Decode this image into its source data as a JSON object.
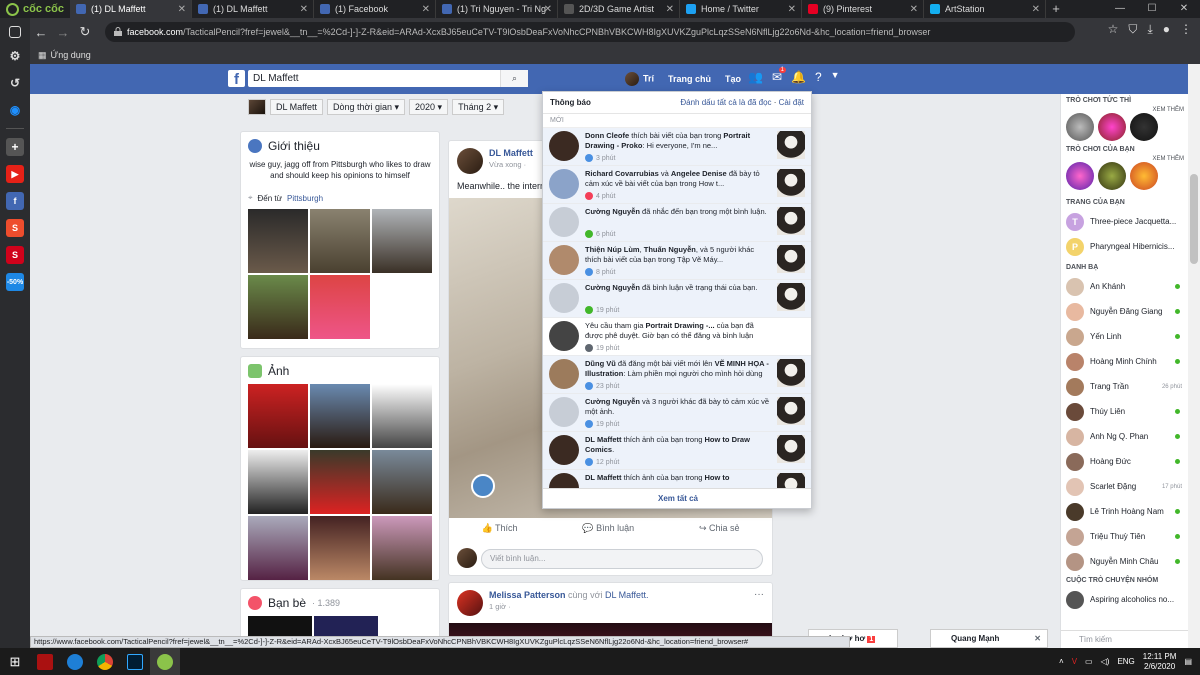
{
  "browser": {
    "brand": "cốc cốc",
    "tabs": [
      {
        "title": "(1) DL Maffett",
        "icon": "facebook-icon",
        "color": "#4267b2"
      },
      {
        "title": "(1) DL Maffett",
        "icon": "facebook-icon",
        "color": "#4267b2"
      },
      {
        "title": "(1) Facebook",
        "icon": "facebook-icon",
        "color": "#4267b2"
      },
      {
        "title": "(1) Tri Nguyen - Tri Ng",
        "icon": "facebook-icon",
        "color": "#4267b2"
      },
      {
        "title": "2D/3D Game Artist",
        "icon": "site-icon",
        "color": "#555555"
      },
      {
        "title": "Home / Twitter",
        "icon": "twitter-icon",
        "color": "#1da1f2"
      },
      {
        "title": "(9) Pinterest",
        "icon": "pinterest-icon",
        "color": "#e60023"
      },
      {
        "title": "ArtStation",
        "icon": "artstation-icon",
        "color": "#13aff0"
      }
    ],
    "url_host": "facebook.com",
    "url_rest": "/TacticalPencil?fref=jewel&__tn__=%2Cd-]-]-Z-R&eid=ARAd-XcxBJ65euCeTV-T9lOsbDeaFxVoNhcCPNBhVBKCWH8IgXUVKZguPlcLqzSSeN6NflLjg22o6Nd-&hc_location=friend_browser",
    "bookmark": "Ứng dụng",
    "status_url": "https://www.facebook.com/TacticalPencil?fref=jewel&__tn__=%2Cd-]-]-Z-R&eid=ARAd-XcxBJ65euCeTV-T9lOsbDeaFxVoNhcCPNBhVBKCWH8IgXUVKZguPlcLqzSSeN6NflLjg22o6Nd-&hc_location=friend_browser#"
  },
  "fb": {
    "search_value": "DL Maffett",
    "nav": {
      "user": "Trí",
      "home": "Trang chủ",
      "create": "Tạo",
      "messages_badge": "1"
    },
    "subnav": {
      "name": "DL Maffett",
      "timeline": "Dòng thời gian",
      "year": "2020",
      "month": "Tháng 2"
    },
    "intro": {
      "title": "Giới thiệu",
      "bio": "wise guy, jagg off from Pittsburgh who likes to draw and should keep his opinions to himself",
      "from_label": "Đến từ",
      "from_place": "Pittsburgh"
    },
    "photos": {
      "title": "Ảnh"
    },
    "friends": {
      "title": "Bạn bè",
      "count": "· 1.389"
    },
    "post1": {
      "author": "DL Maffett",
      "time": "Vừa xong ·",
      "text": "Meanwhile.. the intern",
      "like": "Thích",
      "comment": "Bình luận",
      "share": "Chia sẻ",
      "comment_placeholder": "Viết bình luận..."
    },
    "post2": {
      "author": "Melissa Patterson",
      "with": "cùng với",
      "tagged": "DL Maffett.",
      "time": "1 giờ ·",
      "more": "···"
    }
  },
  "notifications": {
    "title": "Thông báo",
    "mark_all": "Đánh dấu tất cả là đã đọc",
    "settings": "Cài đặt",
    "section": "MỚI",
    "see_all": "Xem tất cả",
    "items": [
      {
        "bold1": "Donn Cleofe",
        "text": " thích bài viết của bạn trong ",
        "bold2": "Portrait Drawing - Proko",
        "rest": ": Hi everyone, I'm ne...",
        "time": "3 phút",
        "icon": "like-icon",
        "icon_color": "#4a90e2",
        "avatar": "#3b2a22",
        "read": false
      },
      {
        "bold1": "Richard Covarrubias",
        "text": " và ",
        "bold2": "Angelee Denise",
        "rest": " đã bày tỏ cảm xúc về bài viết của bạn trong How t...",
        "time": "4 phút",
        "icon": "love-icon",
        "icon_color": "#f33e58",
        "avatar": "#8ba3c9",
        "read": false
      },
      {
        "bold1": "Cường Nguyễn",
        "text": " đã nhắc đến bạn trong một bình luận.",
        "bold2": "",
        "rest": "",
        "time": "6 phút",
        "icon": "comment-icon",
        "icon_color": "#42b72a",
        "avatar": "#c7cdd6",
        "read": false
      },
      {
        "bold1": "Thiện Núp Lùm",
        "text": ", ",
        "bold2": "Thuấn Nguyễn",
        "rest": ", và 5 người khác thích bài viết của bạn trong Tập Vẽ Máy...",
        "time": "8 phút",
        "icon": "like-icon",
        "icon_color": "#4a90e2",
        "avatar": "#b08a6c",
        "read": false
      },
      {
        "bold1": "Cường Nguyễn",
        "text": " đã bình luận về trạng thái của bạn.",
        "bold2": "",
        "rest": "",
        "time": "19 phút",
        "icon": "comment-icon",
        "icon_color": "#42b72a",
        "avatar": "#c7cdd6",
        "read": false
      },
      {
        "bold1": "",
        "text": "Yêu cầu tham gia ",
        "bold2": "Portrait Drawing -...",
        "rest": " của bạn đã được phê duyệt. Giờ bạn có thể đăng và bình luận trong nhóm này.",
        "time": "19 phút",
        "icon": "group-icon",
        "icon_color": "#606770",
        "avatar": "#444444",
        "read": true
      },
      {
        "bold1": "Dũng Vũ",
        "text": " đã đăng một bài viết mới lên ",
        "bold2": "VẼ MINH HỌA - Illustration",
        "rest": ": Làm phiền mọi người cho mình hỏi dùng iPad...",
        "time": "23 phút",
        "icon": "post-icon",
        "icon_color": "#4a90e2",
        "avatar": "#9c7b5c",
        "read": false
      },
      {
        "bold1": "Cường Nguyễn",
        "text": " và 3 người khác đã bày tỏ cảm xúc về một ảnh.",
        "bold2": "",
        "rest": "",
        "time": "19 phút",
        "icon": "like-icon",
        "icon_color": "#4a90e2",
        "avatar": "#c7cdd6",
        "read": false
      },
      {
        "bold1": "DL Maffett",
        "text": " thích ảnh của bạn trong ",
        "bold2": "How to Draw Comics",
        "rest": ".",
        "time": "12 phút",
        "icon": "like-icon",
        "icon_color": "#4a90e2",
        "avatar": "#3b2a22",
        "read": false
      },
      {
        "bold1": "DL Maffett",
        "text": " thích ảnh của bạn trong ",
        "bold2": "How to",
        "rest": "",
        "time": "",
        "icon": "like-icon",
        "icon_color": "#4a90e2",
        "avatar": "#3b2a22",
        "read": false
      }
    ]
  },
  "right": {
    "games_title": "TRÒ CHƠI TỨC THÌ",
    "see_more": "XEM THÊM",
    "your_games": "TRÒ CHƠI CỦA BẠN",
    "pages_title": "TRANG CỦA BẠN",
    "pages": [
      {
        "initial": "T",
        "name": "Three-piece Jacquetta...",
        "color": "#c7a2e0"
      },
      {
        "initial": "P",
        "name": "Pharyngeal Hibernicis...",
        "color": "#f3d36b"
      }
    ],
    "contacts_title": "DANH BẠ",
    "contacts": [
      {
        "name": "An Khánh",
        "online": true,
        "time": ""
      },
      {
        "name": "Nguyễn Đăng Giang",
        "online": true,
        "time": ""
      },
      {
        "name": "Yến Linh",
        "online": true,
        "time": ""
      },
      {
        "name": "Hoàng Minh Chính",
        "online": true,
        "time": ""
      },
      {
        "name": "Trang Trần",
        "online": false,
        "time": "26 phút"
      },
      {
        "name": "Thúy Liên",
        "online": true,
        "time": ""
      },
      {
        "name": "Anh Ng Q. Phan",
        "online": true,
        "time": ""
      },
      {
        "name": "Hoàng Đức",
        "online": true,
        "time": ""
      },
      {
        "name": "Scarlet Đặng",
        "online": false,
        "time": "17 phút"
      },
      {
        "name": "Lê Trinh Hoàng Nam",
        "online": true,
        "time": ""
      },
      {
        "name": "Triệu Thuỳ Tiên",
        "online": true,
        "time": ""
      },
      {
        "name": "Nguyễn Minh Châu",
        "online": true,
        "time": ""
      }
    ],
    "convos_title": "CUỘC TRÒ CHUYỆN NHÓM",
    "convo": "Aspiring alcoholics no...",
    "search": "Tìm kiếm"
  },
  "chat": {
    "tab1": "hơ hơ hơ",
    "tab1_badge": "1",
    "tab2": "Quang Mạnh"
  },
  "taskbar": {
    "lang": "ENG",
    "time": "12:11 PM",
    "date": "2/6/2020"
  }
}
